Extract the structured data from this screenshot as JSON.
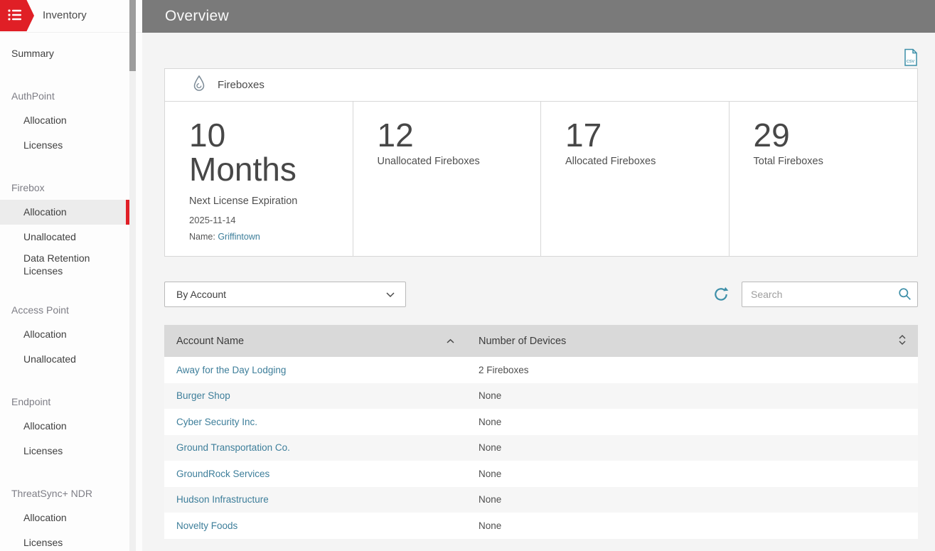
{
  "colors": {
    "accent_red": "#e01f26",
    "link_teal": "#3d7e9a",
    "icon_teal": "#3d8fa8",
    "topbar_gray": "#7a7a7a",
    "table_header_gray": "#d9d9d9"
  },
  "topbar": {
    "title": "Overview"
  },
  "sidebar": {
    "title": "Inventory",
    "items": [
      {
        "label": "Summary"
      },
      {
        "label": "AuthPoint"
      },
      {
        "label": "Allocation"
      },
      {
        "label": "Licenses"
      },
      {
        "label": "Firebox"
      },
      {
        "label": "Allocation"
      },
      {
        "label": "Unallocated"
      },
      {
        "label": "Data Retention Licenses"
      },
      {
        "label": "Access Point"
      },
      {
        "label": "Allocation"
      },
      {
        "label": "Unallocated"
      },
      {
        "label": "Endpoint"
      },
      {
        "label": "Allocation"
      },
      {
        "label": "Licenses"
      },
      {
        "label": "ThreatSync+ NDR"
      },
      {
        "label": "Allocation"
      },
      {
        "label": "Licenses"
      }
    ]
  },
  "card": {
    "title": "Fireboxes",
    "expiration": {
      "value": "10",
      "unit": "Months",
      "label": "Next License Expiration",
      "date": "2025-11-14",
      "name_label": "Name:",
      "name_link": "Griffintown"
    },
    "stats": [
      {
        "value": "12",
        "label": "Unallocated Fireboxes"
      },
      {
        "value": "17",
        "label": "Allocated Fireboxes"
      },
      {
        "value": "29",
        "label": "Total Fireboxes"
      }
    ]
  },
  "controls": {
    "filter_value": "By Account",
    "search_placeholder": "Search"
  },
  "table": {
    "columns": [
      "Account Name",
      "Number of Devices"
    ],
    "rows": [
      {
        "account": "Away for the Day Lodging",
        "devices": "2 Fireboxes"
      },
      {
        "account": "Burger Shop",
        "devices": "None"
      },
      {
        "account": "Cyber Security Inc.",
        "devices": "None"
      },
      {
        "account": "Ground Transportation Co.",
        "devices": "None"
      },
      {
        "account": "GroundRock Services",
        "devices": "None"
      },
      {
        "account": "Hudson Infrastructure",
        "devices": "None"
      },
      {
        "account": "Novelty Foods",
        "devices": "None"
      }
    ]
  }
}
